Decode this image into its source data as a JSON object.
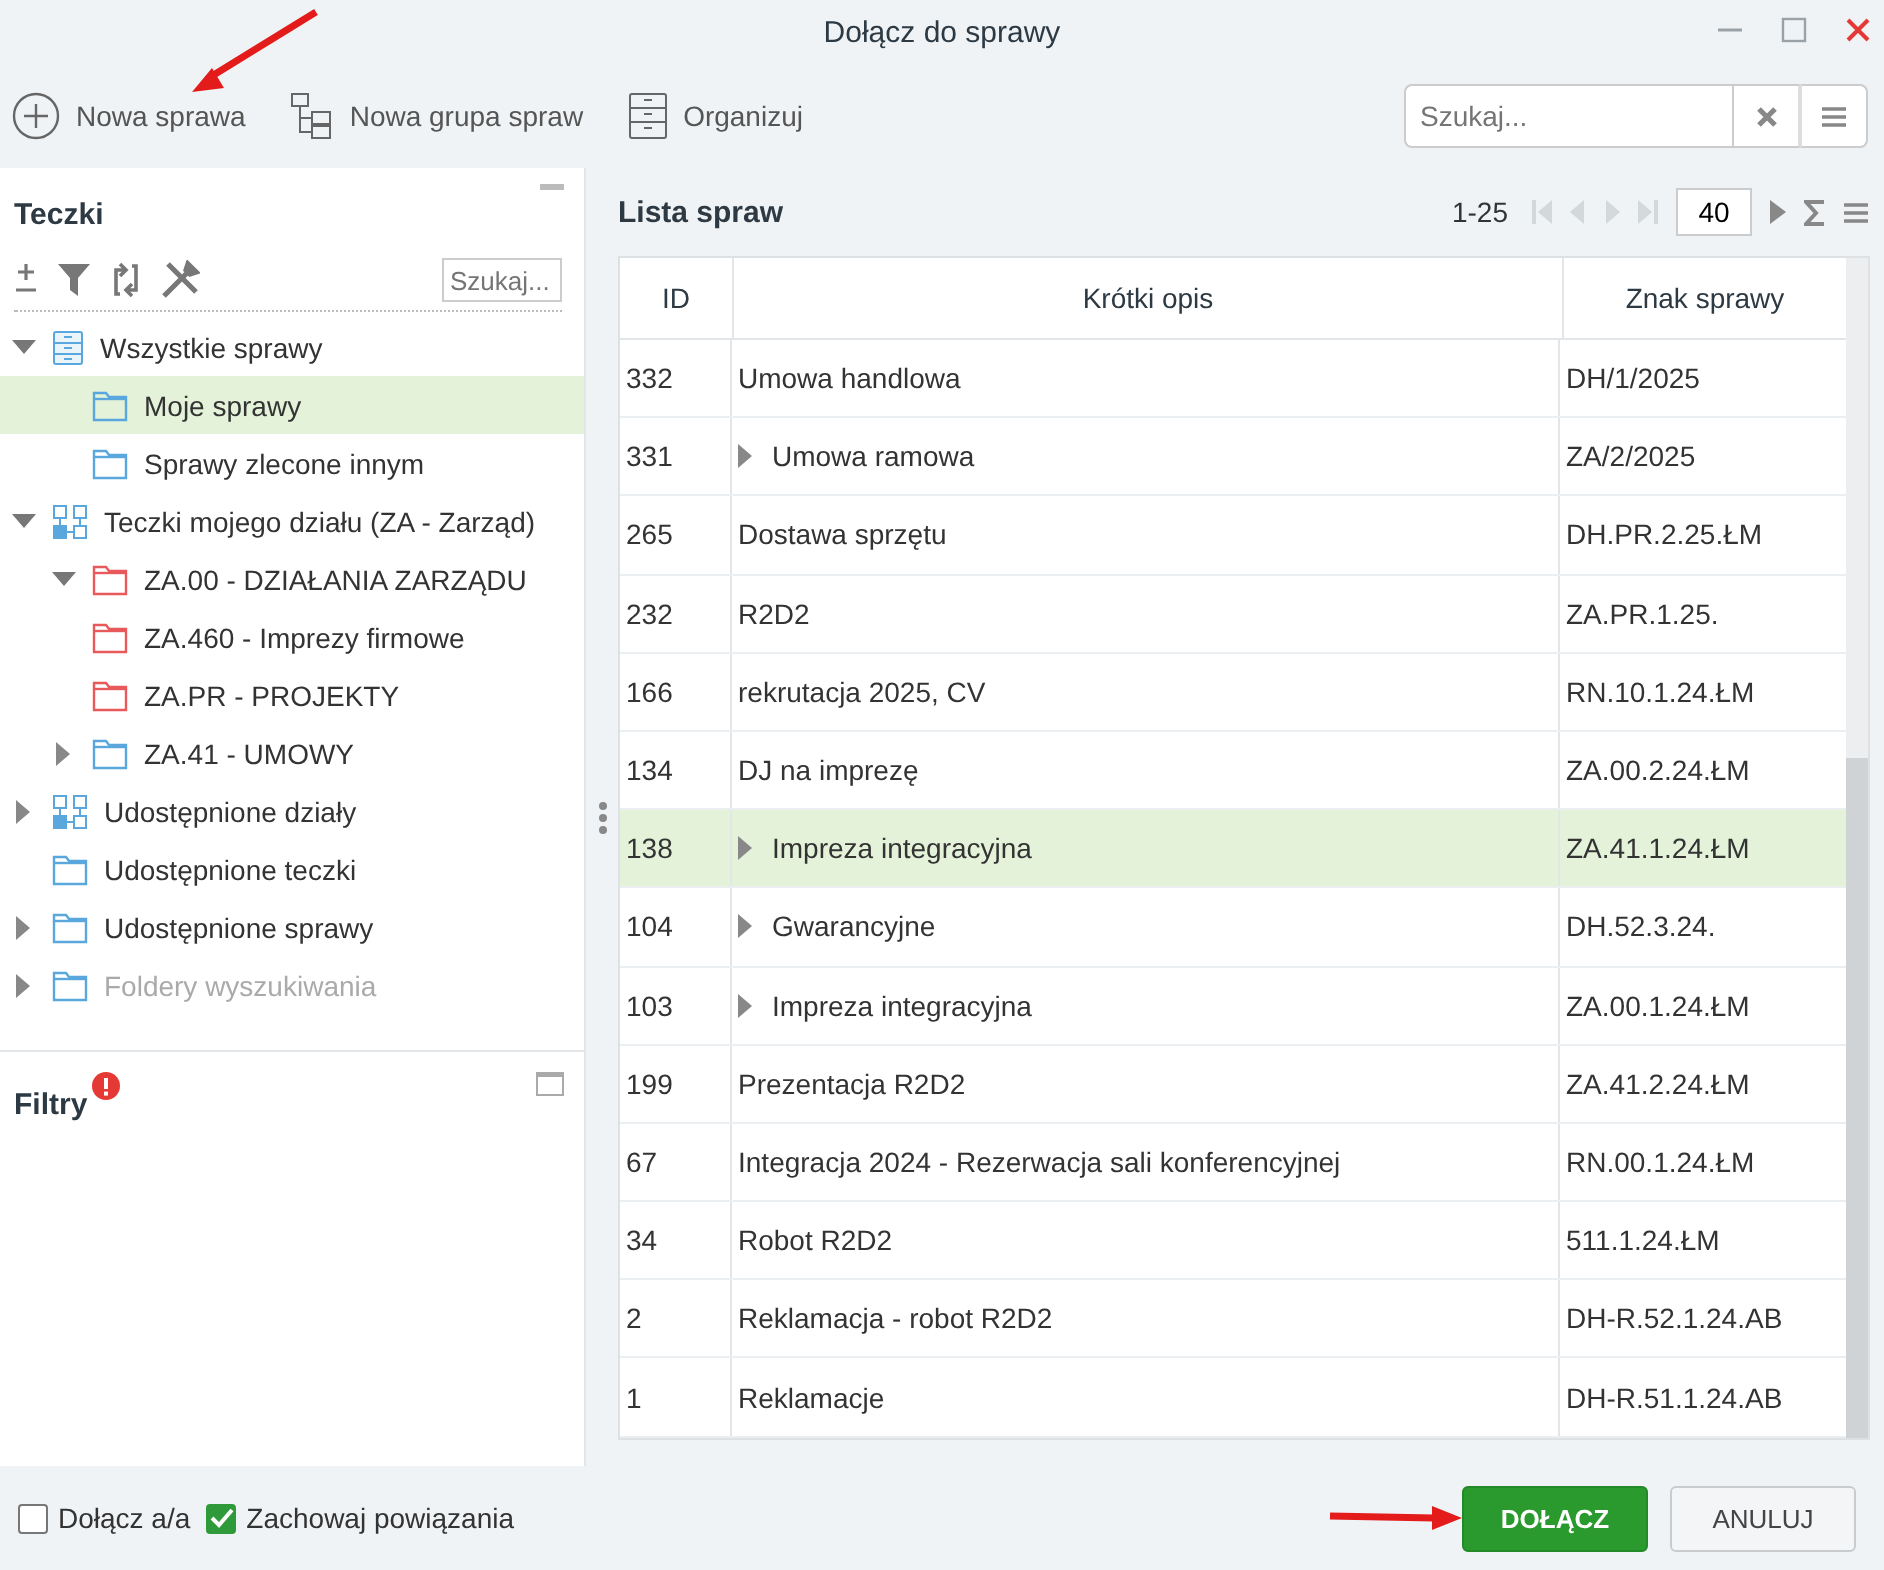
{
  "window": {
    "title": "Dołącz do sprawy"
  },
  "toolbar": [
    "Nowa sprawa",
    "Nowa grupa spraw",
    "Organizuj"
  ],
  "search": {
    "placeholder": "Szukaj..."
  },
  "folders_panel": {
    "title": "Teczki",
    "search_placeholder": "Szukaj...",
    "tree": [
      {
        "label": "Wszystkie sprawy",
        "kind": "cabinet",
        "expanded": true,
        "selected": false,
        "disabled": false,
        "children": [
          {
            "label": "Moje sprawy",
            "kind": "folder",
            "color": "#5aa7dd",
            "selected": true,
            "disabled": false
          },
          {
            "label": "Sprawy zlecone innym",
            "kind": "folder",
            "color": "#5aa7dd",
            "selected": false,
            "disabled": false
          }
        ]
      },
      {
        "label": "Teczki mojego działu (ZA - Zarząd)",
        "kind": "department",
        "expanded": true,
        "selected": false,
        "disabled": false,
        "children": [
          {
            "label": "ZA.00 - DZIAŁANIA ZARZĄDU",
            "kind": "folder",
            "color": "#e8595c",
            "expanded": true,
            "selected": false,
            "disabled": false
          },
          {
            "label": "ZA.460 - Imprezy firmowe",
            "kind": "folder",
            "color": "#e8595c",
            "selected": false,
            "disabled": false
          },
          {
            "label": "ZA.PR - PROJEKTY",
            "kind": "folder",
            "color": "#e8595c",
            "selected": false,
            "disabled": false
          },
          {
            "label": "ZA.41 - UMOWY",
            "kind": "folder",
            "color": "#5aa7dd",
            "expanded": false,
            "selected": false,
            "disabled": false
          }
        ]
      },
      {
        "label": "Udostępnione działy",
        "kind": "department",
        "expanded": false,
        "selected": false,
        "disabled": false
      },
      {
        "label": "Udostępnione teczki",
        "kind": "folder",
        "color": "#5aa7dd",
        "selected": false,
        "disabled": false
      },
      {
        "label": "Udostępnione sprawy",
        "kind": "folder",
        "color": "#5aa7dd",
        "expanded": false,
        "selected": false,
        "disabled": false
      },
      {
        "label": "Foldery wyszukiwania",
        "kind": "folder",
        "color": "#5aa7dd",
        "expanded": false,
        "selected": false,
        "disabled": true
      }
    ]
  },
  "filters_panel": {
    "title": "Filtry",
    "alert": true
  },
  "case_list": {
    "title": "Lista spraw",
    "range": "1-25",
    "page_size": "40",
    "columns": [
      "ID",
      "Krótki opis",
      "Znak sprawy"
    ],
    "rows": [
      {
        "id": "332",
        "description": "Umowa handlowa",
        "sign": "DH/1/2025",
        "expandable": false,
        "selected": false
      },
      {
        "id": "331",
        "description": "Umowa ramowa",
        "sign": "ZA/2/2025",
        "expandable": true,
        "selected": false
      },
      {
        "id": "265",
        "description": "Dostawa sprzętu",
        "sign": "DH.PR.2.25.ŁM",
        "expandable": false,
        "selected": false
      },
      {
        "id": "232",
        "description": "R2D2",
        "sign": "ZA.PR.1.25.",
        "expandable": false,
        "selected": false
      },
      {
        "id": "166",
        "description": "rekrutacja 2025, CV",
        "sign": "RN.10.1.24.ŁM",
        "expandable": false,
        "selected": false
      },
      {
        "id": "134",
        "description": "DJ na imprezę",
        "sign": "ZA.00.2.24.ŁM",
        "expandable": false,
        "selected": false
      },
      {
        "id": "138",
        "description": "Impreza integracyjna",
        "sign": "ZA.41.1.24.ŁM",
        "expandable": true,
        "selected": true
      },
      {
        "id": "104",
        "description": "Gwarancyjne",
        "sign": "DH.52.3.24.",
        "expandable": true,
        "selected": false
      },
      {
        "id": "103",
        "description": "Impreza integracyjna",
        "sign": "ZA.00.1.24.ŁM",
        "expandable": true,
        "selected": false
      },
      {
        "id": "199",
        "description": "Prezentacja R2D2",
        "sign": "ZA.41.2.24.ŁM",
        "expandable": false,
        "selected": false
      },
      {
        "id": "67",
        "description": "Integracja 2024 - Rezerwacja sali konferencyjnej",
        "sign": "RN.00.1.24.ŁM",
        "expandable": false,
        "selected": false
      },
      {
        "id": "34",
        "description": "Robot R2D2",
        "sign": "511.1.24.ŁM",
        "expandable": false,
        "selected": false
      },
      {
        "id": "2",
        "description": "Reklamacja - robot R2D2",
        "sign": "DH-R.52.1.24.AB",
        "expandable": false,
        "selected": false
      },
      {
        "id": "1",
        "description": "Reklamacje",
        "sign": "DH-R.51.1.24.AB",
        "expandable": false,
        "selected": false
      }
    ]
  },
  "options": [
    {
      "label": "Dołącz a/a",
      "checked": false
    },
    {
      "label": "Zachowaj powiązania",
      "checked": true
    }
  ],
  "buttons": [
    {
      "label": "DOŁĄCZ",
      "kind": "primary"
    },
    {
      "label": "ANULUJ",
      "kind": "secondary"
    }
  ]
}
